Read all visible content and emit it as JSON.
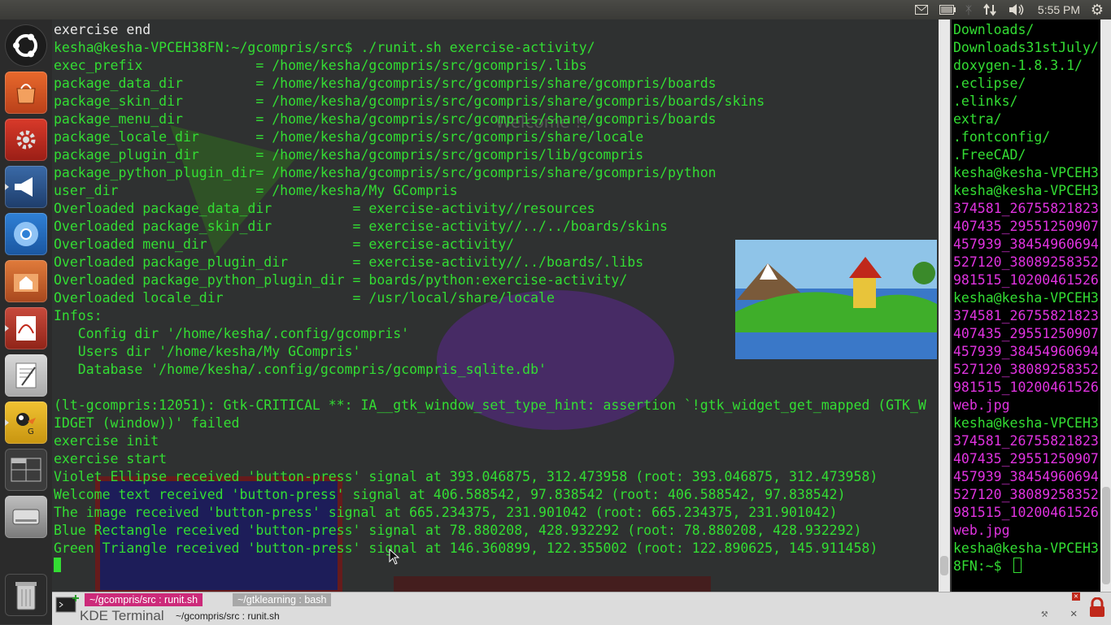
{
  "top_panel": {
    "clock": "5:55 PM",
    "icons": [
      "mail-icon",
      "battery-icon",
      "bluetooth-icon",
      "network-icon",
      "volume-icon",
      "gear-icon"
    ]
  },
  "launcher": {
    "items": [
      "ubuntu-logo-icon",
      "software-center-icon",
      "system-settings-icon",
      "gwibber-icon",
      "chromium-icon",
      "files-icon",
      "document-viewer-icon",
      "text-editor-icon",
      "gcompris-icon",
      "workspace-switcher-icon",
      "drive-icon",
      "trash-icon"
    ]
  },
  "terminal_main": {
    "lines": [
      {
        "t": "exercise end",
        "c": "w"
      },
      {
        "t": "kesha@kesha-VPCEH38FN:~/gcompris/src$ ./runit.sh exercise-activity/",
        "c": "g"
      },
      {
        "t": "exec_prefix              = /home/kesha/gcompris/src/gcompris/.libs",
        "c": "g"
      },
      {
        "t": "package_data_dir         = /home/kesha/gcompris/src/gcompris/share/gcompris/boards",
        "c": "g"
      },
      {
        "t": "package_skin_dir         = /home/kesha/gcompris/src/gcompris/share/gcompris/boards/skins",
        "c": "g"
      },
      {
        "t": "package_menu_dir         = /home/kesha/gcompris/src/gcompris/share/gcompris/boards",
        "c": "g"
      },
      {
        "t": "package_locale_dir       = /home/kesha/gcompris/src/gcompris/share/locale",
        "c": "g"
      },
      {
        "t": "package_plugin_dir       = /home/kesha/gcompris/src/gcompris/lib/gcompris",
        "c": "g"
      },
      {
        "t": "package_python_plugin_dir= /home/kesha/gcompris/src/gcompris/share/gcompris/python",
        "c": "g"
      },
      {
        "t": "user_dir                 = /home/kesha/My GCompris",
        "c": "g"
      },
      {
        "t": "Overloaded package_data_dir          = exercise-activity//resources",
        "c": "g"
      },
      {
        "t": "Overloaded package_skin_dir          = exercise-activity//../../boards/skins",
        "c": "g"
      },
      {
        "t": "Overloaded menu_dir                  = exercise-activity/",
        "c": "g"
      },
      {
        "t": "Overloaded package_plugin_dir        = exercise-activity//../boards/.libs",
        "c": "g"
      },
      {
        "t": "Overloaded package_python_plugin_dir = boards/python:exercise-activity/",
        "c": "g"
      },
      {
        "t": "Overloaded locale_dir                = /usr/local/share/locale",
        "c": "g"
      },
      {
        "t": "Infos:",
        "c": "g"
      },
      {
        "t": "   Config dir '/home/kesha/.config/gcompris'",
        "c": "g"
      },
      {
        "t": "   Users dir '/home/kesha/My GCompris'",
        "c": "g"
      },
      {
        "t": "   Database '/home/kesha/.config/gcompris/gcompris_sqlite.db'",
        "c": "g"
      },
      {
        "t": "",
        "c": "g"
      },
      {
        "t": "(lt-gcompris:12051): Gtk-CRITICAL **: IA__gtk_window_set_type_hint: assertion `!gtk_widget_get_mapped (GTK_W",
        "c": "g"
      },
      {
        "t": "IDGET (window))' failed",
        "c": "g"
      },
      {
        "t": "exercise init",
        "c": "g"
      },
      {
        "t": "exercise start",
        "c": "g"
      },
      {
        "t": "Violet Ellipse received 'button-press' signal at 393.046875, 312.473958 (root: 393.046875, 312.473958)",
        "c": "g"
      },
      {
        "t": "Welcome text received 'button-press' signal at 406.588542, 97.838542 (root: 406.588542, 97.838542)",
        "c": "g"
      },
      {
        "t": "The image received 'button-press' signal at 665.234375, 231.901042 (root: 665.234375, 231.901042)",
        "c": "g"
      },
      {
        "t": "Blue Rectangle received 'button-press' signal at 78.880208, 428.932292 (root: 78.880208, 428.932292)",
        "c": "g"
      },
      {
        "t": "Green Triangle received 'button-press' signal at 146.360899, 122.355002 (root: 122.890625, 145.911458)",
        "c": "g"
      }
    ]
  },
  "background_app": {
    "welcome_text": "Welcome !!"
  },
  "terminal_right": {
    "lines": [
      {
        "t": "Downloads/",
        "c": "g"
      },
      {
        "t": "Downloads31stJuly/",
        "c": "g"
      },
      {
        "t": "doxygen-1.8.3.1/",
        "c": "g"
      },
      {
        "t": ".eclipse/",
        "c": "g"
      },
      {
        "t": ".elinks/",
        "c": "g"
      },
      {
        "t": "extra/",
        "c": "g"
      },
      {
        "t": ".fontconfig/",
        "c": "g"
      },
      {
        "t": ".FreeCAD/",
        "c": "g"
      },
      {
        "t": "kesha@kesha-VPCEH3",
        "c": "g"
      },
      {
        "t": "kesha@kesha-VPCEH3",
        "c": "g"
      },
      {
        "t": "374581_26755821823",
        "c": "m"
      },
      {
        "t": "407435_29551250907",
        "c": "m"
      },
      {
        "t": "457939_38454960694",
        "c": "m"
      },
      {
        "t": "527120_38089258352",
        "c": "m"
      },
      {
        "t": "981515_10200461526",
        "c": "m"
      },
      {
        "t": "kesha@kesha-VPCEH3",
        "c": "g"
      },
      {
        "t": "374581_26755821823",
        "c": "m"
      },
      {
        "t": "407435_29551250907",
        "c": "m"
      },
      {
        "t": "457939_38454960694",
        "c": "m"
      },
      {
        "t": "527120_38089258352",
        "c": "m"
      },
      {
        "t": "981515_10200461526",
        "c": "m"
      },
      {
        "t": "web.jpg",
        "c": "m"
      },
      {
        "t": "kesha@kesha-VPCEH3",
        "c": "g"
      },
      {
        "t": "374581_26755821823",
        "c": "m"
      },
      {
        "t": "407435_29551250907",
        "c": "m"
      },
      {
        "t": "457939_38454960694",
        "c": "m"
      },
      {
        "t": "527120_38089258352",
        "c": "m"
      },
      {
        "t": "981515_10200461526",
        "c": "m"
      },
      {
        "t": "web.jpg",
        "c": "m"
      },
      {
        "t": "kesha@kesha-VPCEH3",
        "c": "g"
      },
      {
        "t": "8FN:~$ ",
        "c": "g"
      }
    ]
  },
  "tabbar": {
    "tab1": "~/gcompris/src : runit.sh",
    "tab2": "~/gtklearning : bash",
    "app_title": "KDE Terminal",
    "path": "~/gcompris/src : runit.sh"
  },
  "colors": {
    "terminal_green": "#33dd33",
    "terminal_magenta": "#e033e0",
    "active_tab": "#cc2a7a"
  }
}
